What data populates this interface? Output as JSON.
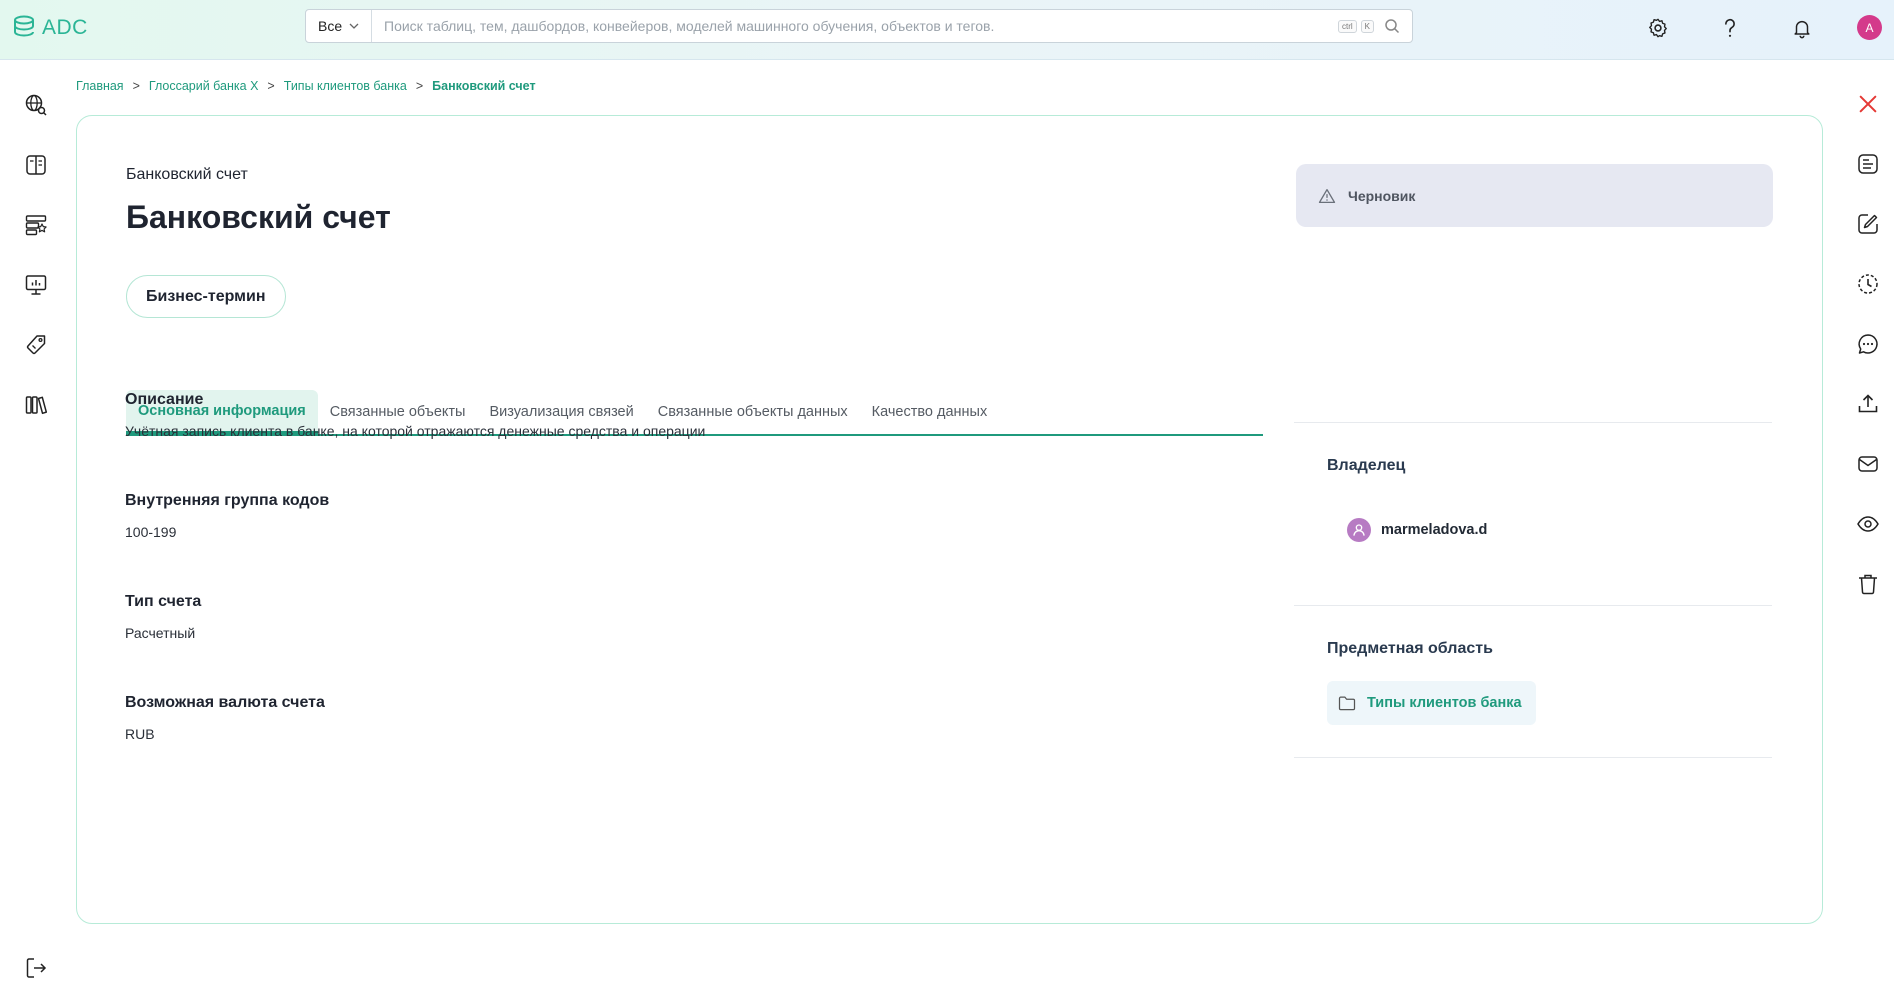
{
  "header": {
    "logo_text": "ADC",
    "search": {
      "scope": "Все",
      "placeholder": "Поиск таблиц, тем, дашбордов, конвейеров, моделей машинного обучения, объектов и тегов.",
      "shortcut_ctrl": "ctrl",
      "shortcut_key": "K"
    },
    "icons": [
      "gear-icon",
      "help-icon",
      "bell-icon"
    ],
    "user_initial": "A"
  },
  "left_nav": [
    "globe-search-icon",
    "book-icon",
    "database-star-icon",
    "monitor-chart-icon",
    "tag-icon",
    "library-icon",
    "logout-icon"
  ],
  "right_nav": [
    "close-icon",
    "details-icon",
    "edit-icon",
    "history-icon",
    "comment-icon",
    "upload-icon",
    "mail-icon",
    "eye-icon",
    "trash-icon"
  ],
  "breadcrumb": {
    "items": [
      "Главная",
      "Глоссарий банка X",
      "Типы клиентов банка"
    ],
    "separator": ">",
    "current": "Банковский счет"
  },
  "entity": {
    "subtitle": "Банковский счет",
    "title": "Банковский счет",
    "type": "Бизнес-термин"
  },
  "tabs": [
    {
      "label": "Основная информация",
      "active": true
    },
    {
      "label": "Связанные объекты",
      "active": false
    },
    {
      "label": "Визуализация связей",
      "active": false
    },
    {
      "label": "Связанные объекты данных",
      "active": false
    },
    {
      "label": "Качество данных",
      "active": false
    }
  ],
  "fields": [
    {
      "label": "Описание",
      "value": "Учётная запись клиента в банке, на которой отражаются денежные средства и операции"
    },
    {
      "label": "Внутренняя группа кодов",
      "value": "100-199"
    },
    {
      "label": "Тип счета",
      "value": "Расчетный"
    },
    {
      "label": "Возможная валюта счета",
      "value": "RUB"
    }
  ],
  "side_panel": {
    "status": "Черновик",
    "owner_title": "Владелец",
    "owner_name": "marmeladova.d",
    "domain_title": "Предметная область",
    "domain_name": "Типы клиентов банка"
  },
  "colors": {
    "accent": "#1f9a7d",
    "status_bg": "#e6e8f2",
    "avatar": "#d43a8b",
    "close": "#e53935"
  }
}
